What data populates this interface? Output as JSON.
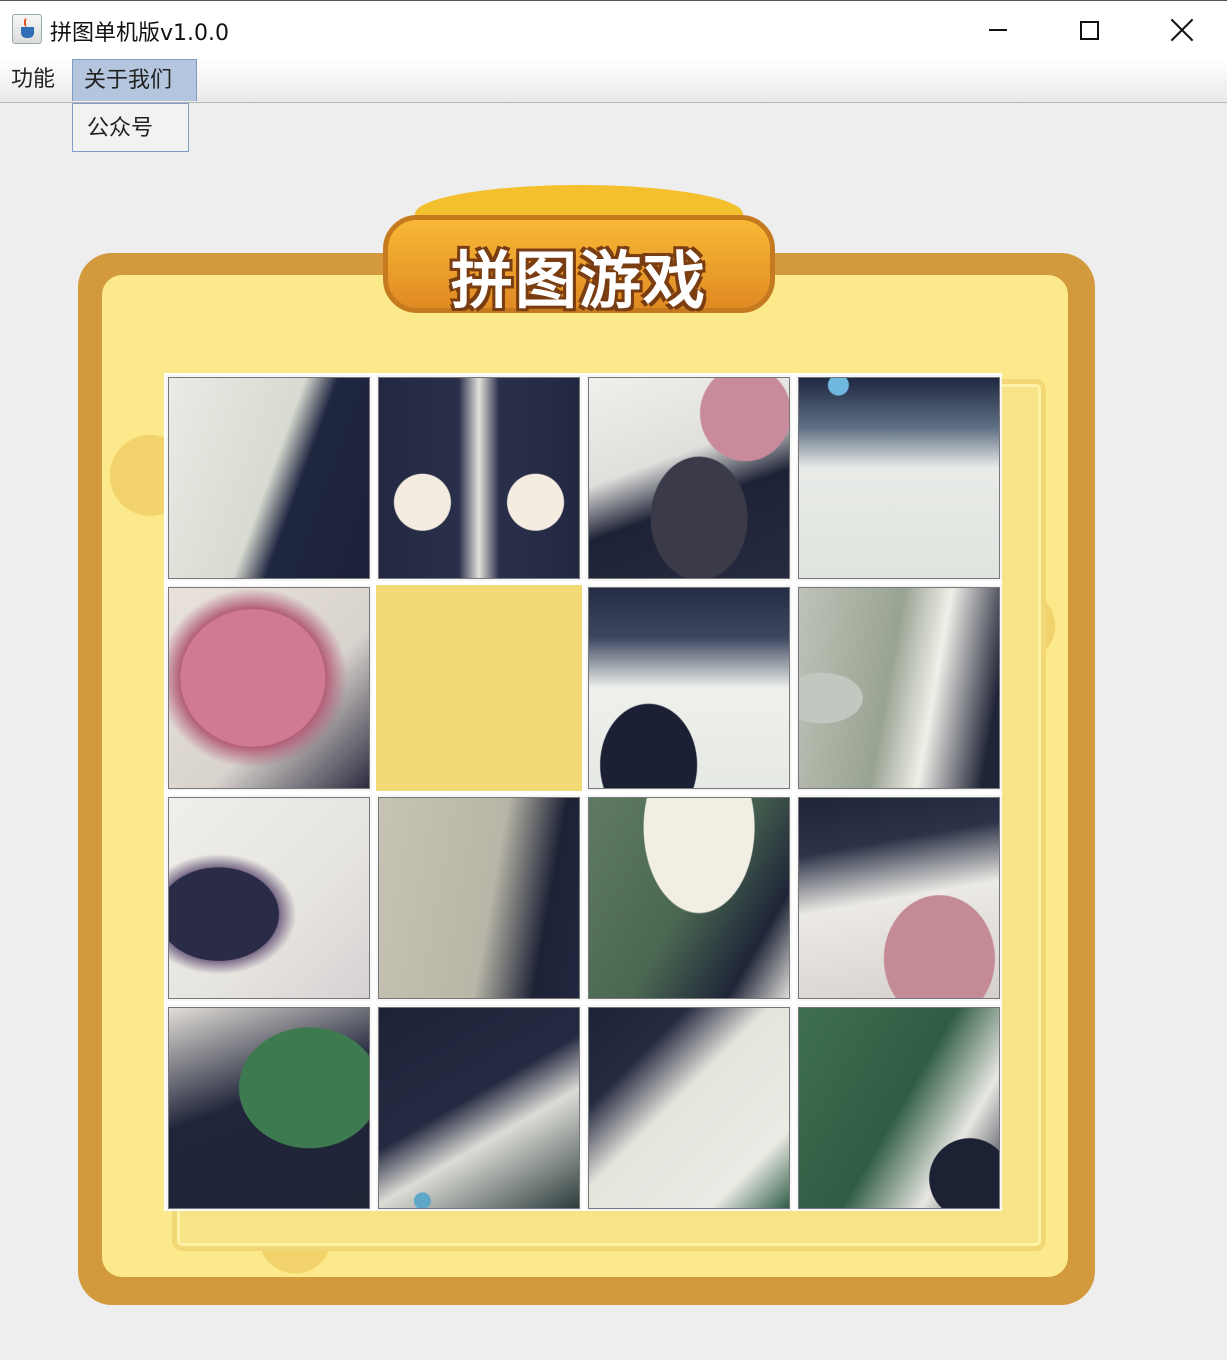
{
  "window": {
    "title": "拼图单机版v1.0.0",
    "controls": [
      "minimize",
      "maximize",
      "close"
    ]
  },
  "menu": {
    "items": [
      "功能",
      "关于我们"
    ],
    "open_index": 1,
    "dropdown_items": [
      "公众号"
    ]
  },
  "game": {
    "banner_title": "拼图游戏",
    "grid_rows": 4,
    "grid_cols": 4,
    "empty_tile": {
      "row": 1,
      "col": 1
    },
    "colors": {
      "frame": "#d29a3c",
      "board": "#fbe98b",
      "empty_tile": "#f3da74",
      "menu_highlight": "#b4c6dd"
    },
    "tiles": [
      {
        "row": 0,
        "col": 0,
        "bg": "linear-gradient(110deg, #e9ebe5 0%, #d8dbd1 50%, #1f2640 62%, #1c2138 100%)"
      },
      {
        "row": 0,
        "col": 1,
        "bg": "radial-gradient(circle at 22% 62%, #f4ece0 0 28px, transparent 29px), radial-gradient(circle at 78% 62%, #f4ece0 0 28px, transparent 29px), linear-gradient(90deg, #222842 0%, #2a2f4a 40%, #e4e2dc 50%, #2a2f4a 60%, #222842 100%)"
      },
      {
        "row": 0,
        "col": 2,
        "bg": "radial-gradient(ellipse at 78% 18%, #c98b9c 0 45px, transparent 46px), radial-gradient(ellipse at 55% 70%, #3a3a48 0 48px, transparent 49px), linear-gradient(160deg, #f1f0eb 0%, #dfdfdc 40%, #1d2236 60%, #262b41 100%)"
      },
      {
        "row": 0,
        "col": 3,
        "bg": "radial-gradient(circle at 20% 4%, #6fb8df 0 10px, transparent 11px), linear-gradient(180deg, #1e2740 0%, #5f6f84 25%, #e8ebe7 45%, #e0e4df 100%)"
      },
      {
        "row": 1,
        "col": 0,
        "bg": "radial-gradient(ellipse at 42% 45%, #d07a93 0 72px, #b35f79 73px, transparent 95px), linear-gradient(135deg, #e9e2dc 0%, #d9d3ce 60%, #2a2a3e 100%)"
      },
      {
        "row": 1,
        "col": 2,
        "bg": "radial-gradient(ellipse at 30% 88%, #1c2034 0 48px, transparent 49px), linear-gradient(180deg, #232c44 0%, #3c4760 25%, #eef0ec 50%, #e6e9e4 100%)"
      },
      {
        "row": 1,
        "col": 3,
        "bg": "radial-gradient(ellipse at 12% 55%, #c2c8c0 0 40px, transparent 41px), linear-gradient(100deg, #bfc3b7 0%, #99a393 45%, #f0efe9 65%, #1f2436 92%)"
      },
      {
        "row": 2,
        "col": 0,
        "bg": "radial-gradient(ellipse at 25% 58%, #2a2b46 0 60px, #7d6e8a 61px, transparent 78px), linear-gradient(135deg, #f0efea 0%, #e6e4df 60%, #d7d1d3 100%)"
      },
      {
        "row": 2,
        "col": 1,
        "bg": "linear-gradient(100deg, #c7c3b4 0%, #b8b6a7 55%, #1d2236 80%, #222740 100%)"
      },
      {
        "row": 2,
        "col": 2,
        "bg": "radial-gradient(ellipse at 55% 15%, #f1eee4 0 55px, transparent 56px), linear-gradient(120deg, #5f7b63 0%, #4a6752 50%, #1f2538 80%, #e3e2dc 100%)"
      },
      {
        "row": 2,
        "col": 3,
        "bg": "radial-gradient(ellipse at 70% 80%, #c48b97 0 55px, transparent 56px), linear-gradient(170deg, #1f2438 0%, #2c3348 25%, #eceae5 50%, #d5d0cb 100%)"
      },
      {
        "row": 3,
        "col": 0,
        "bg": "radial-gradient(ellipse at 70% 40%, #3e7a4f 0 70px, transparent 71px), linear-gradient(160deg, #e4e0d9 0%, #20253a 45%, #1e2336 100%)"
      },
      {
        "row": 3,
        "col": 1,
        "bg": "radial-gradient(circle at 22% 96%, #5ea7c8 0 8px, transparent 9px), linear-gradient(150deg, #1e2238 0%, #252a42 45%, #dcdcd6 62%, #2a3a3a 100%)"
      },
      {
        "row": 3,
        "col": 2,
        "bg": "linear-gradient(135deg, #1d2236 0%, #262b41 25%, #e5e4dd 45%, #eceae4 80%, #2b5a45 100%)"
      },
      {
        "row": 3,
        "col": 3,
        "bg": "radial-gradient(ellipse at 85% 85%, #1c2134 0 40px, transparent 41px), linear-gradient(120deg, #3f6f50 0%, #2f5c44 50%, #e8e7e1 75%, #1f2438 100%)"
      }
    ]
  }
}
